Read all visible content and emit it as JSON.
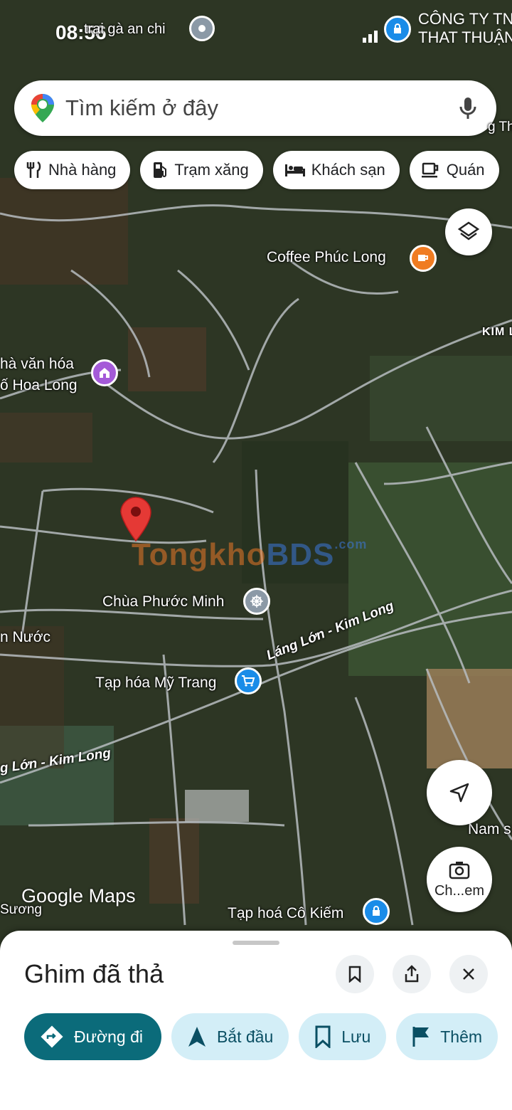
{
  "status": {
    "time": "08:56",
    "notification_text": "trại gà an chi",
    "carrier_lines": [
      "CÔNG TY TN",
      "THAT THUẬN"
    ]
  },
  "search": {
    "placeholder": "Tìm kiếm ở đây"
  },
  "chips": [
    {
      "label": "Nhà hàng",
      "icon": "restaurant-icon"
    },
    {
      "label": "Trạm xăng",
      "icon": "gas-station-icon"
    },
    {
      "label": "Khách sạn",
      "icon": "hotel-icon"
    },
    {
      "label": "Quán",
      "icon": "cafe-icon"
    }
  ],
  "map_labels": {
    "coffee": "Coffee Phúc Long",
    "kim": "KIM L",
    "nha_van_hoa_1": "hà văn hóa",
    "nha_van_hoa_2": "ố Hoa Long",
    "chua": "Chùa Phước Minh",
    "nuoc": "n Nước",
    "tap_hoa_my_trang": "Tạp hóa Mỹ Trang",
    "road_1": "Láng Lớn - Kim Long",
    "road_2": "g Lớn - Kim Long",
    "nam": "Nam s",
    "suong": "Sương",
    "tap_hoa_co_kiem": "Tạp hoá Cô Kiếm",
    "thu": "g Thủ",
    "watermark_a": "Tongkho",
    "watermark_b": "BDS",
    "watermark_c": ".com"
  },
  "map_branding": "Google Maps",
  "lens_label": "Ch...em",
  "sheet": {
    "title": "Ghim đã thả",
    "actions": [
      {
        "label": "Đường đi",
        "icon": "directions-icon"
      },
      {
        "label": "Bắt đầu",
        "icon": "navigation-arrow-icon"
      },
      {
        "label": "Lưu",
        "icon": "bookmark-icon"
      },
      {
        "label": "Thêm",
        "icon": "flag-icon"
      }
    ]
  },
  "colors": {
    "primary_action": "#0b6b7a",
    "secondary_action": "#d3eef7",
    "pin": "#e53935",
    "coffee_poi": "#f07c22",
    "culture_poi": "#a45ad8",
    "store_poi": "#1a8ce8"
  }
}
